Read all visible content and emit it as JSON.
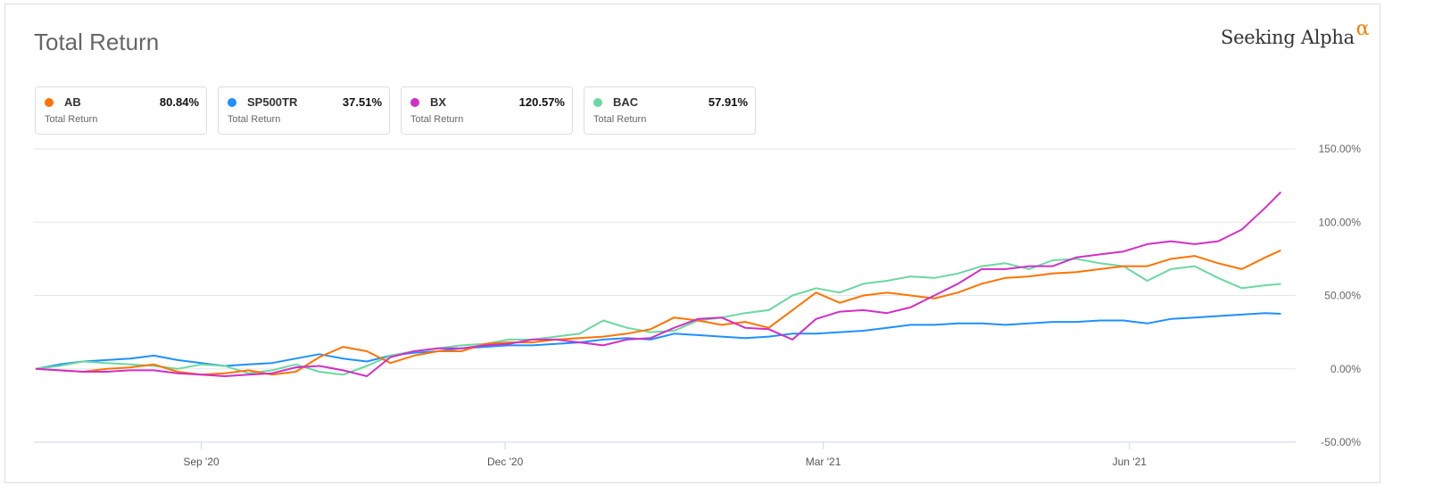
{
  "title": "Total Return",
  "logo": {
    "text": "Seeking Alpha",
    "mark": "α"
  },
  "legend": [
    {
      "symbol": "AB",
      "value": "80.84%",
      "subtitle": "Total Return",
      "color": "#ff7300"
    },
    {
      "symbol": "SP500TR",
      "value": "37.51%",
      "subtitle": "Total Return",
      "color": "#1e90ff"
    },
    {
      "symbol": "BX",
      "value": "120.57%",
      "subtitle": "Total Return",
      "color": "#d12fc6"
    },
    {
      "symbol": "BAC",
      "value": "57.91%",
      "subtitle": "Total Return",
      "color": "#6ad8a0"
    }
  ],
  "chart_data": {
    "type": "line",
    "title": "Total Return",
    "xlabel": "",
    "ylabel": "",
    "x_unit": "weeks since mid-Jul 2020",
    "x": [
      0,
      1,
      2,
      3,
      4,
      5,
      6,
      7,
      8,
      9,
      10,
      11,
      12,
      13,
      14,
      15,
      16,
      17,
      18,
      19,
      20,
      21,
      22,
      23,
      24,
      25,
      26,
      27,
      28,
      29,
      30,
      31,
      32,
      33,
      34,
      35,
      36,
      37,
      38,
      39,
      40,
      41,
      42,
      43,
      44,
      45,
      46,
      47,
      48,
      49,
      50,
      51,
      52,
      52.65
    ],
    "xlim": [
      0,
      53.2
    ],
    "x_ticks": [
      {
        "label": "Sep '20",
        "at": 7
      },
      {
        "label": "Dec '20",
        "at": 19.85
      },
      {
        "label": "Mar '21",
        "at": 33.3
      },
      {
        "label": "Jun '21",
        "at": 46.25
      }
    ],
    "ylim": [
      -50,
      150
    ],
    "y_ticks": [
      {
        "v": 150,
        "label": "150.00%"
      },
      {
        "v": 100,
        "label": "100.00%"
      },
      {
        "v": 50,
        "label": "50.00%"
      },
      {
        "v": 0,
        "label": "0.00%"
      },
      {
        "v": -50,
        "label": "-50.00%"
      }
    ],
    "grid": true,
    "series": [
      {
        "name": "SP500TR",
        "color": "#1e90ff",
        "values": [
          0,
          3,
          5,
          6,
          7,
          9,
          6,
          4,
          2,
          3,
          4,
          7,
          10,
          7,
          5,
          9,
          11,
          12,
          14,
          15,
          16,
          16,
          17,
          18,
          20,
          21,
          20,
          24,
          23,
          22,
          21,
          22,
          24,
          24,
          25,
          26,
          28,
          30,
          30,
          31,
          31,
          30,
          31,
          32,
          32,
          33,
          33,
          31,
          34,
          35,
          36,
          37,
          38,
          37.51
        ]
      },
      {
        "name": "BAC",
        "color": "#6ad8a0",
        "values": [
          0,
          2,
          5,
          4,
          3,
          2,
          0,
          3,
          2,
          -3,
          -1,
          3,
          -2,
          -4,
          2,
          9,
          12,
          14,
          16,
          17,
          20,
          20,
          22,
          24,
          33,
          28,
          25,
          26,
          33,
          35,
          38,
          40,
          50,
          55,
          52,
          58,
          60,
          63,
          62,
          65,
          70,
          72,
          68,
          74,
          75,
          72,
          70,
          60,
          68,
          70,
          62,
          55,
          57,
          57.91
        ]
      },
      {
        "name": "AB",
        "color": "#ff7300",
        "values": [
          0,
          -1,
          -2,
          0,
          1,
          3,
          -2,
          -4,
          -3,
          -1,
          -4,
          -2,
          8,
          15,
          12,
          4,
          9,
          12,
          12,
          17,
          18,
          18,
          20,
          21,
          22,
          24,
          27,
          35,
          33,
          30,
          32,
          28,
          40,
          52,
          45,
          50,
          52,
          50,
          48,
          52,
          58,
          62,
          63,
          65,
          66,
          68,
          70,
          70,
          75,
          77,
          72,
          68,
          76,
          80.84
        ]
      },
      {
        "name": "BX",
        "color": "#d12fc6",
        "values": [
          0,
          -1,
          -2,
          -2,
          -1,
          -1,
          -3,
          -4,
          -5,
          -4,
          -3,
          1,
          2,
          -1,
          -5,
          8,
          12,
          14,
          14,
          16,
          17,
          20,
          20,
          18,
          16,
          20,
          21,
          28,
          34,
          35,
          28,
          27,
          20,
          34,
          39,
          40,
          38,
          42,
          50,
          58,
          68,
          68,
          70,
          70,
          76,
          78,
          80,
          85,
          87,
          85,
          87,
          95,
          110,
          120.57
        ]
      }
    ]
  }
}
